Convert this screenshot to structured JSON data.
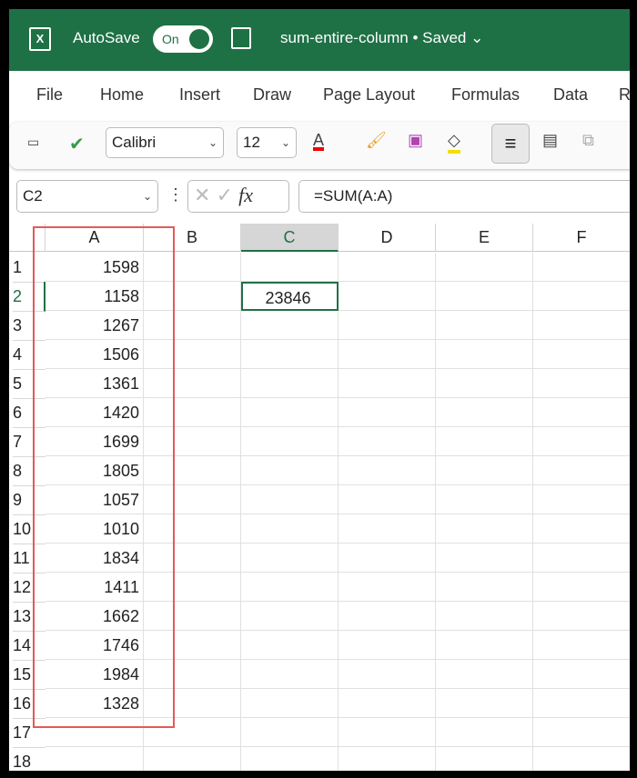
{
  "titlebar": {
    "autosave_label": "AutoSave",
    "toggle_label": "On",
    "document": "sum-entire-column • Saved ⌄"
  },
  "tabs": [
    "File",
    "Home",
    "Insert",
    "Draw",
    "Page Layout",
    "Formulas",
    "Data",
    "R"
  ],
  "toolbar": {
    "font": "Calibri",
    "size": "12"
  },
  "formula_bar": {
    "name_box": "C2",
    "formula": "=SUM(A:A)",
    "fx": "fx"
  },
  "columns": [
    "A",
    "B",
    "C",
    "D",
    "E",
    "F"
  ],
  "rows": [
    "1",
    "2",
    "3",
    "4",
    "5",
    "6",
    "7",
    "8",
    "9",
    "10",
    "11",
    "12",
    "13",
    "14",
    "15",
    "16",
    "17",
    "18"
  ],
  "column_a": [
    "1598",
    "1158",
    "1267",
    "1506",
    "1361",
    "1420",
    "1699",
    "1805",
    "1057",
    "1010",
    "1834",
    "1411",
    "1662",
    "1746",
    "1984",
    "1328"
  ],
  "c2": "23846",
  "colors": {
    "brand": "#1e7145",
    "highlight": "#e35a5a"
  }
}
